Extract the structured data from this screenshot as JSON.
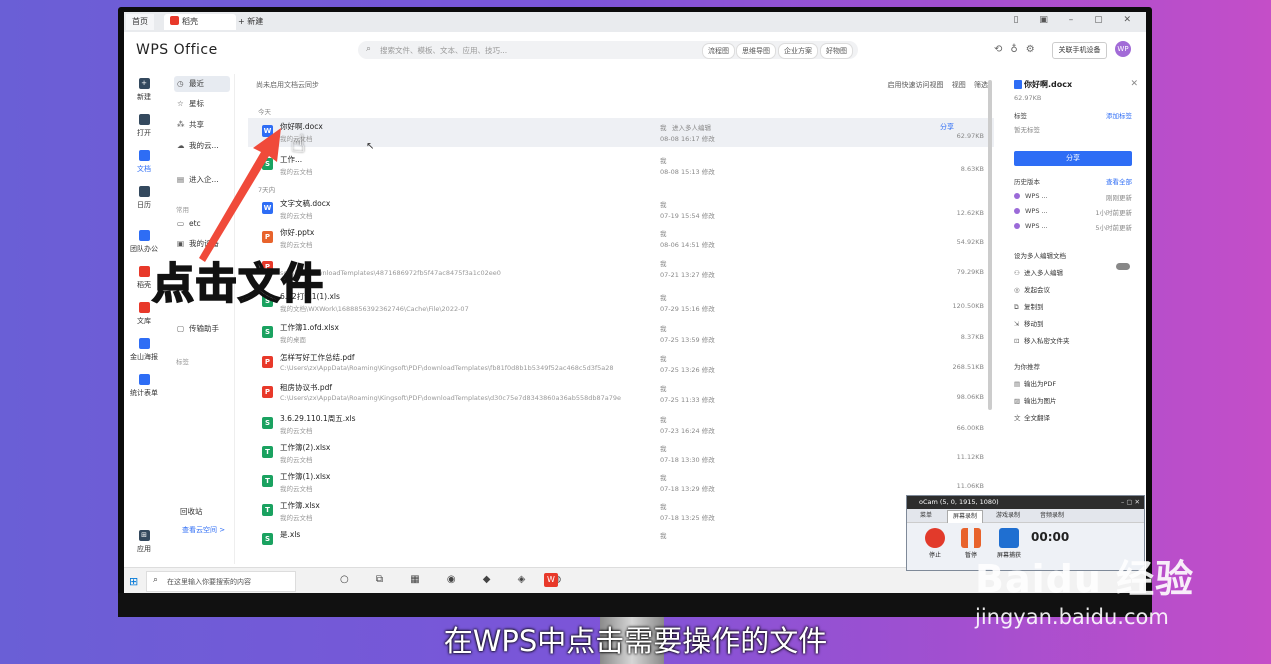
{
  "titlebar": {
    "home_tab": "首页",
    "doc_tab": "稻壳",
    "new_tab": "+ 新建",
    "window_controls": "▯ ▣ – ▢ ✕"
  },
  "header": {
    "brand": "WPS Office",
    "search_placeholder": "搜索文件、模板、文本、应用、技巧...",
    "pills": [
      "流程图",
      "思维导图",
      "企业方案",
      "好物图"
    ],
    "phone_button": "关联手机设备",
    "avatar": "WP"
  },
  "rail": [
    {
      "label": "新建",
      "icon": "plus-icon"
    },
    {
      "label": "打开",
      "icon": "folder-icon"
    },
    {
      "label": "文档",
      "icon": "document-icon",
      "active": true
    },
    {
      "label": "日历",
      "icon": "calendar-icon"
    },
    {
      "label": "团队办公",
      "icon": "team-icon"
    },
    {
      "label": "稻壳",
      "icon": "docer-icon"
    },
    {
      "label": "文库",
      "icon": "library-icon"
    },
    {
      "label": "金山海报",
      "icon": "poster-icon"
    },
    {
      "label": "统计表单",
      "icon": "form-icon"
    },
    {
      "label": "应用",
      "icon": "apps-icon"
    }
  ],
  "nav": {
    "items": [
      {
        "label": "最近",
        "icon": "clock-icon"
      },
      {
        "label": "星标",
        "icon": "star-icon"
      },
      {
        "label": "共享",
        "icon": "share-icon"
      },
      {
        "label": "我的云...",
        "icon": "cloud-icon"
      },
      {
        "label": "进入企...",
        "icon": "building-icon"
      }
    ],
    "section_common": "常用",
    "common_items": [
      {
        "label": "etc",
        "icon": "folder-icon"
      },
      {
        "label": "我的设备",
        "icon": "device-icon"
      },
      {
        "label": "传输助手",
        "icon": "transfer-icon"
      }
    ],
    "section_tags": "标签",
    "recycle": "回收站",
    "cloud_space": "查看云空间 >"
  },
  "main": {
    "sync_hint": "尚未启用文档云同步",
    "tools": [
      "启用快速访问视图",
      "视图",
      "筛选"
    ],
    "group_today": "今天",
    "group_week": "7天内",
    "files": [
      {
        "name": "你好啊.docx",
        "path": "我的云文档",
        "owner": "我",
        "date": "08-08 16:17 修改",
        "collab": "进入多人编辑",
        "share": "分享",
        "size": "62.97KB",
        "type": "W",
        "color": "#2e6df5",
        "selected": true
      },
      {
        "name": "工作...",
        "path": "我的云文档",
        "owner": "我",
        "date": "08-08 15:13 修改",
        "size": "8.63KB",
        "type": "S",
        "color": "#1aa260"
      },
      {
        "name": "文字文稿.docx",
        "path": "我的云文档",
        "owner": "我",
        "date": "07-19 15:54 修改",
        "size": "12.62KB",
        "type": "W",
        "color": "#2e6df5"
      },
      {
        "name": "你好.pptx",
        "path": "我的云文档",
        "owner": "我",
        "date": "08-06 14:51 修改",
        "size": "54.92KB",
        "type": "P",
        "color": "#e8632c"
      },
      {
        "name": "",
        "path": "soft\\PDF\\downloadTemplates\\4871686972fb5f47ac8475f3a1c02ee0",
        "owner": "我",
        "date": "07-21 13:27 修改",
        "size": "79.29KB",
        "type": "P",
        "color": "#e8392a"
      },
      {
        "name": "6.22打包1(1).xls",
        "path": "我的文档\\WXWork\\1688856392362746\\Cache\\File\\2022-07",
        "owner": "我",
        "date": "07-29 15:16 修改",
        "size": "120.50KB",
        "type": "S",
        "color": "#1aa260"
      },
      {
        "name": "工作簿1.ofd.xlsx",
        "path": "我的桌面",
        "owner": "我",
        "date": "07-25 13:59 修改",
        "size": "8.37KB",
        "type": "S",
        "color": "#1aa260"
      },
      {
        "name": "怎样写好工作总结.pdf",
        "path": "C:\\Users\\zx\\AppData\\Roaming\\Kingsoft\\PDF\\downloadTemplates\\fb81f0d8b1b5349f52ac468c5d3f5a28",
        "owner": "我",
        "date": "07-25 13:26 修改",
        "size": "268.51KB",
        "type": "P",
        "color": "#e8392a"
      },
      {
        "name": "租房协议书.pdf",
        "path": "C:\\Users\\zx\\AppData\\Roaming\\Kingsoft\\PDF\\downloadTemplates\\d30c75e7d8343860a36ab558db87a79e",
        "owner": "我",
        "date": "07-25 11:33 修改",
        "size": "98.06KB",
        "type": "P",
        "color": "#e8392a"
      },
      {
        "name": "3.6.29.110.1周五.xls",
        "path": "我的云文档",
        "owner": "我",
        "date": "07-23 16:24 修改",
        "size": "66.00KB",
        "type": "S",
        "color": "#1aa260"
      },
      {
        "name": "工作簿(2).xlsx",
        "path": "我的云文档",
        "owner": "我",
        "date": "07-18 13:30 修改",
        "size": "11.12KB",
        "type": "T",
        "color": "#1aa260"
      },
      {
        "name": "工作簿(1).xlsx",
        "path": "我的云文档",
        "owner": "我",
        "date": "07-18 13:29 修改",
        "size": "11.06KB",
        "type": "T",
        "color": "#1aa260"
      },
      {
        "name": "工作簿.xlsx",
        "path": "我的云文档",
        "owner": "我",
        "date": "07-18 13:25 修改",
        "size": "",
        "type": "T",
        "color": "#1aa260"
      },
      {
        "name": "是.xls",
        "path": "",
        "owner": "我",
        "date": "",
        "size": "",
        "type": "S",
        "color": "#1aa260"
      }
    ]
  },
  "detail": {
    "title": "你好啊.docx",
    "size": "62.97KB",
    "tag_label": "标签",
    "add_tag": "添加标签",
    "no_tag": "暂无标签",
    "share_button": "分享",
    "history_label": "历史版本",
    "view_all": "查看全部",
    "versions": [
      {
        "name": "WPS ...",
        "time": "刚刚更新"
      },
      {
        "name": "WPS ...",
        "time": "1小时前更新"
      },
      {
        "name": "WPS ...",
        "time": "5小时前更新"
      }
    ],
    "actions": [
      "设为多人编辑文档",
      "进入多人编辑",
      "发起会议",
      "复制到",
      "移动到",
      "移入私密文件夹"
    ],
    "recommend_label": "为你推荐",
    "recommend": [
      "输出为PDF",
      "输出为图片",
      "全文翻译"
    ]
  },
  "taskbar": {
    "search_text": "在这里输入你要搜索的内容",
    "icons": "○ ⧉ ▦ ◉ ◆ ◈ ◍"
  },
  "ocam": {
    "title": "oCam (5, 0, 1915, 1080)",
    "tabs": [
      "菜单",
      "屏幕录制",
      "游戏录制",
      "音频录制"
    ],
    "buttons": [
      "停止",
      "暂停",
      "屏幕捕获"
    ],
    "time": "00:00"
  },
  "overlay": {
    "click_text": "点击文件",
    "caption": "在WPS中点击需要操作的文件"
  },
  "watermark": {
    "brand": "Baidu 经验",
    "url": "jingyan.baidu.com"
  }
}
